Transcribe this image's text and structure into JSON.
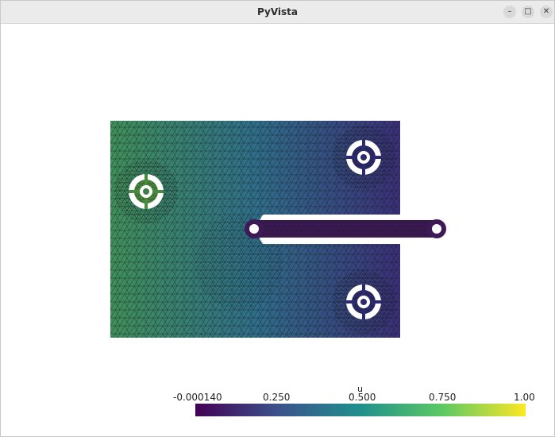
{
  "window": {
    "title": "PyVista",
    "minimize_glyph": "–",
    "maximize_glyph": "□",
    "close_glyph": "✕"
  },
  "scalar_bar": {
    "title": "u",
    "labels": [
      "-0.000140",
      "0.250",
      "0.500",
      "0.750",
      "1.00"
    ],
    "colormap": "viridis",
    "colors": [
      "#440154",
      "#3b528b",
      "#21908d",
      "#5dc963",
      "#fde725"
    ]
  },
  "mesh": {
    "colors": {
      "left_edge": "#3f8f5a",
      "middle": "#2f6e8a",
      "right_edge": "#3a2f78",
      "arm": "#3d1a57",
      "wire": "#151515"
    }
  }
}
